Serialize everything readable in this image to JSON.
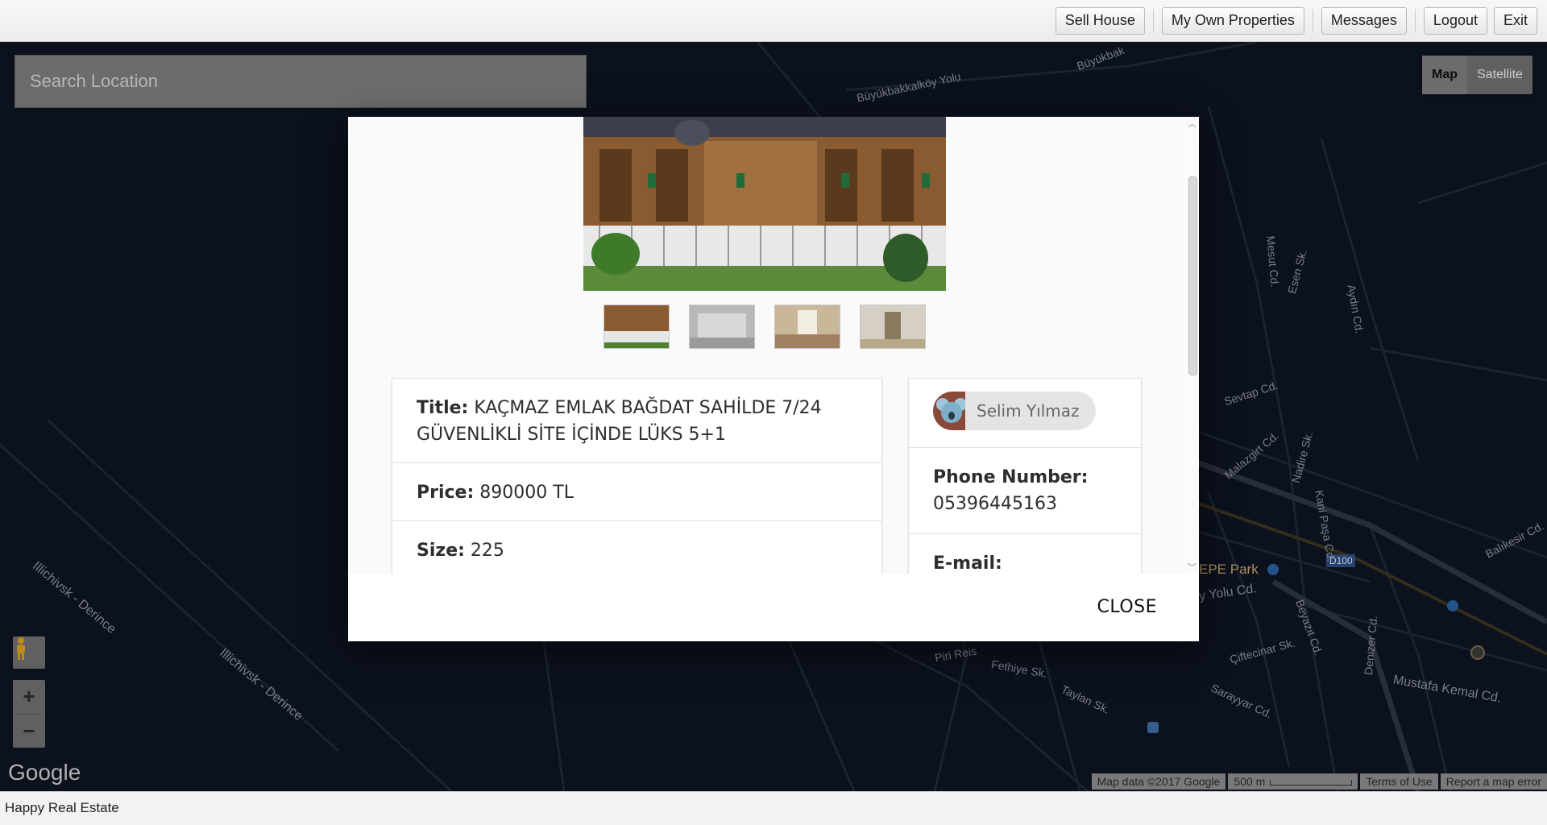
{
  "toolbar": {
    "buttons": [
      "Sell House",
      "My Own Properties",
      "Messages",
      "Logout",
      "Exit"
    ]
  },
  "map": {
    "search_placeholder": "Search Location",
    "map_type": {
      "map": "Map",
      "satellite": "Satellite",
      "selected": "Map"
    },
    "zoom_in": "+",
    "zoom_out": "−",
    "logo": "Google",
    "attribution": [
      "Map data ©2017 Google",
      "500 m",
      "Terms of Use",
      "Report a map error"
    ],
    "labels": {
      "illichivsk_1": "Illichivsk - Derince",
      "illichivsk_2": "Illichivsk - Derince",
      "buyukbakkalkoy": "Büyükbakkalköy Yolu",
      "buyukbak": "Büyükbak",
      "tepe_park": "EPE Park",
      "d100": "D100",
      "mustafa_kemal": "Mustafa Kemal Cd.",
      "piri_reis": "Piri Reis",
      "fethiye": "Fethiye Sk.",
      "taylan": "Taylan Sk.",
      "sarayyar": "Sarayyar Cd.",
      "ciftecinar": "Çiftecinar Sk.",
      "kani_pasa": "Kani Paşa Cd.",
      "nadire": "Nadire Sk.",
      "malazgirt": "Malazgirt Cd.",
      "sevtap": "Sevtap Cd.",
      "esen": "Esen Sk.",
      "mesut": "Mesut Cd.",
      "aydin": "Aydın Cd.",
      "balikesir": "Balıkesir Cd.",
      "denizer": "Denizer Cd.",
      "beyazit": "Beyazıt Cd.",
      "yolu_cd": "y Yolu Cd."
    }
  },
  "modal": {
    "title_label": "Title:",
    "title_value": "KAÇMAZ EMLAK BAĞDAT SAHİLDE 7/24 GÜVENLİKLİ SİTE İÇİNDE LÜKS 5+1",
    "price_label": "Price:",
    "price_value": "890000 TL",
    "size_label": "Size:",
    "size_value": "225",
    "owner_name": "Selim Yılmaz",
    "phone_label": "Phone Number:",
    "phone_value": "05396445163",
    "email_label": "E-mail:",
    "close_label": "CLOSE"
  },
  "status": {
    "app_name": "Happy Real Estate"
  },
  "colors": {
    "map_bg": "#0d1422",
    "modal_bg": "#ffffff"
  }
}
